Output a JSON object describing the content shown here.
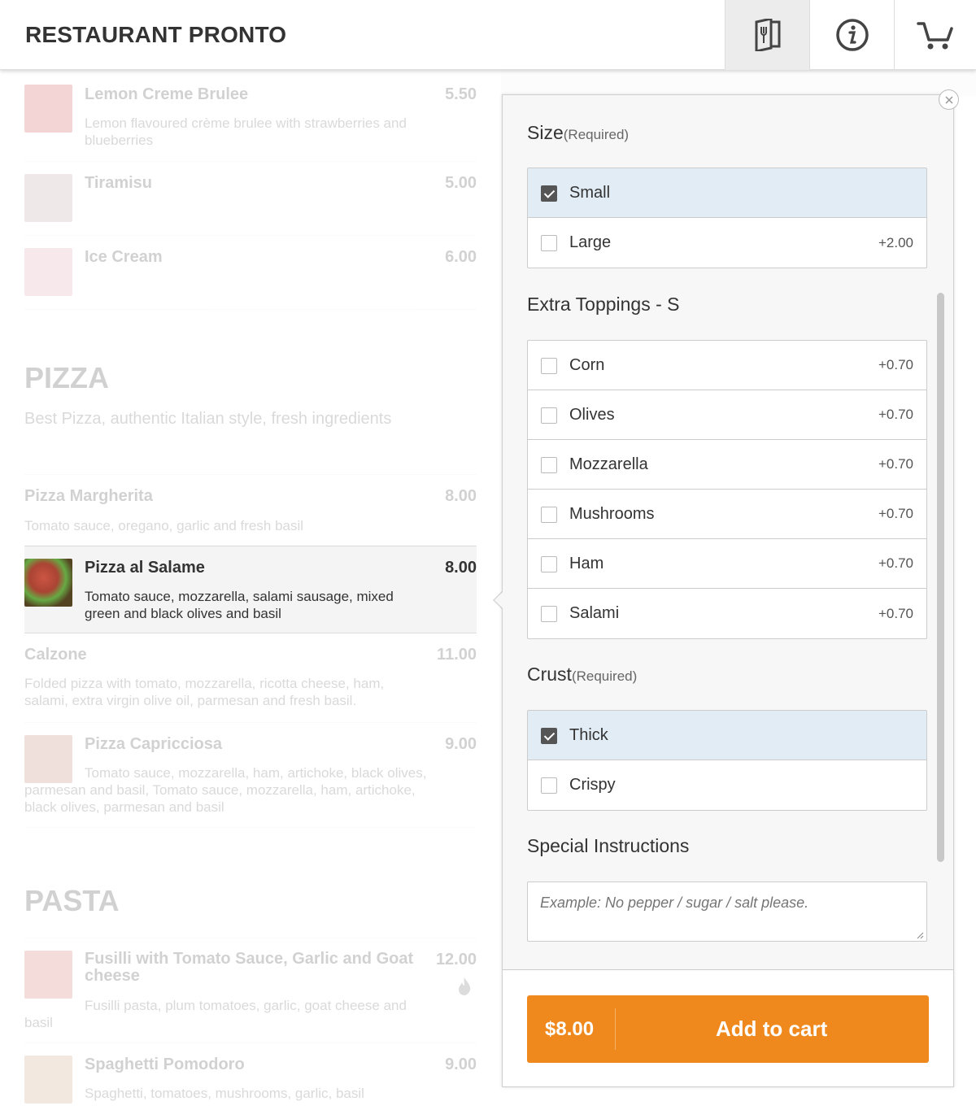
{
  "header": {
    "brand": "RESTAURANT PRONTO",
    "icons": [
      "menu-book-icon",
      "info-icon",
      "cart-icon"
    ]
  },
  "menu": {
    "desserts": [
      {
        "name": "Lemon Creme Brulee",
        "price": "5.50",
        "desc": "Lemon flavoured crème brulee with strawberries and blueberries"
      },
      {
        "name": "Tiramisu",
        "price": "5.00",
        "desc": ""
      },
      {
        "name": "Ice Cream",
        "price": "6.00",
        "desc": ""
      }
    ],
    "pizza_section": {
      "title": "PIZZA",
      "subtitle": "Best Pizza, authentic Italian style, fresh ingredients",
      "items": [
        {
          "name": "Pizza Margherita",
          "price": "8.00",
          "desc": "Tomato sauce, oregano, garlic and fresh basil"
        },
        {
          "name": "Pizza al Salame",
          "price": "8.00",
          "desc": "Tomato sauce, mozzarella, salami sausage, mixed green and black olives and basil"
        },
        {
          "name": "Calzone",
          "price": "11.00",
          "desc": "Folded pizza with tomato, mozzarella, ricotta cheese, ham, salami, extra virgin olive oil, parmesan and fresh basil."
        },
        {
          "name": "Pizza Capricciosa",
          "price": "9.00",
          "desc": "Tomato sauce, mozzarella, ham, artichoke, black olives, parmesan and basil, Tomato sauce, mozzarella, ham, artichoke, black olives, parmesan and basil"
        }
      ]
    },
    "pasta_section": {
      "title": "PASTA",
      "items": [
        {
          "name": "Fusilli with Tomato Sauce, Garlic and Goat cheese",
          "price": "12.00",
          "desc": "Fusilli pasta, plum tomatoes, garlic, goat cheese and basil"
        },
        {
          "name": "Spaghetti Pomodoro",
          "price": "9.00",
          "desc": "Spaghetti, tomatoes, mushrooms, garlic, basil"
        }
      ]
    }
  },
  "options": {
    "size": {
      "title": "Size",
      "required": "(Required)",
      "choices": [
        {
          "label": "Small",
          "price": "",
          "checked": true
        },
        {
          "label": "Large",
          "price": "+2.00",
          "checked": false
        }
      ]
    },
    "toppings": {
      "title": "Extra Toppings - S",
      "choices": [
        {
          "label": "Corn",
          "price": "+0.70",
          "checked": false
        },
        {
          "label": "Olives",
          "price": "+0.70",
          "checked": false
        },
        {
          "label": "Mozzarella",
          "price": "+0.70",
          "checked": false
        },
        {
          "label": "Mushrooms",
          "price": "+0.70",
          "checked": false
        },
        {
          "label": "Ham",
          "price": "+0.70",
          "checked": false
        },
        {
          "label": "Salami",
          "price": "+0.70",
          "checked": false
        }
      ]
    },
    "crust": {
      "title": "Crust",
      "required": "(Required)",
      "choices": [
        {
          "label": "Thick",
          "price": "",
          "checked": true
        },
        {
          "label": "Crispy",
          "price": "",
          "checked": false
        }
      ]
    },
    "instructions": {
      "title": "Special Instructions",
      "placeholder": "Example: No pepper / sugar / salt please."
    }
  },
  "cart_button": {
    "price": "$8.00",
    "label": "Add to cart"
  },
  "colors": {
    "accent": "#f0891d",
    "selected_bg": "#e1ecf4"
  }
}
